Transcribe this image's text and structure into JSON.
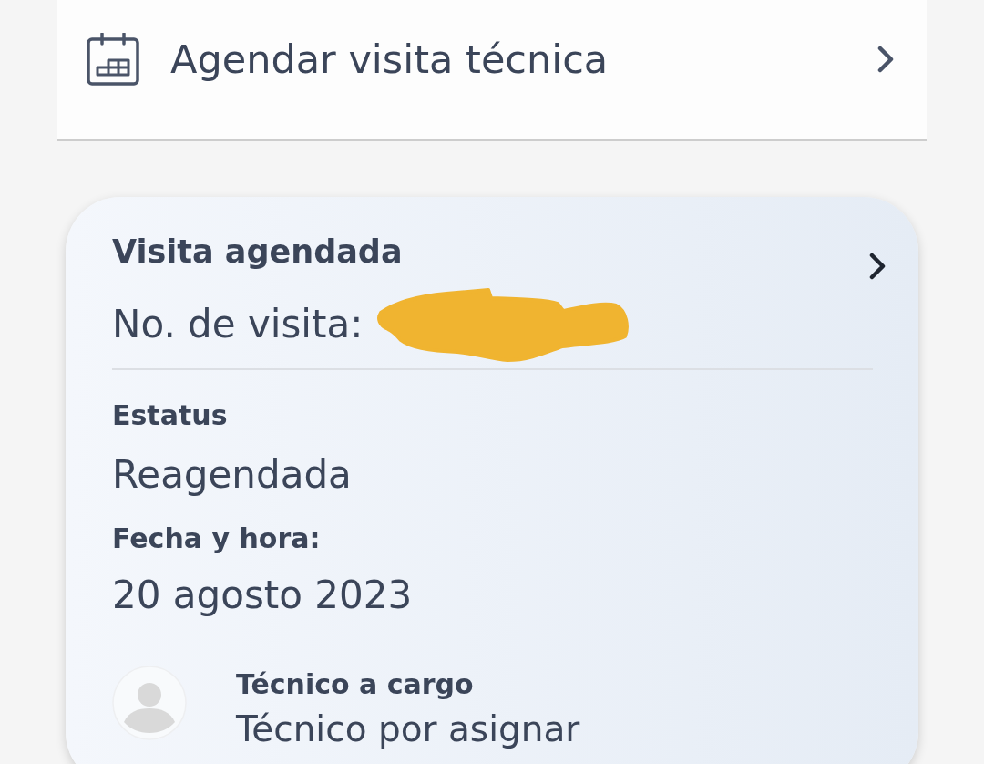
{
  "action_item": {
    "label": "Agendar visita técnica"
  },
  "visit_card": {
    "title": "Visita agendada",
    "visit_number_label": "No. de visita:",
    "fields": [
      {
        "label": "Estatus",
        "value": "Reagendada"
      },
      {
        "label": "Fecha y hora:",
        "value": "20 agosto 2023"
      }
    ],
    "technician": {
      "label": "Técnico a cargo",
      "name": "Técnico por asignar"
    }
  }
}
